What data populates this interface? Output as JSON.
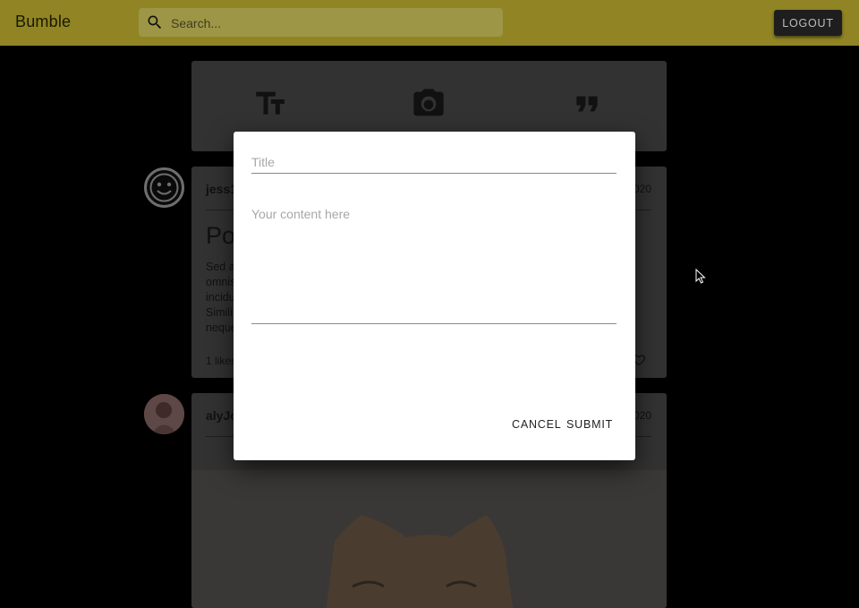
{
  "app": {
    "title": "Bumble"
  },
  "search": {
    "placeholder": "Search...",
    "icon": "search-icon"
  },
  "header": {
    "logout_label": "LOGOUT"
  },
  "composer": {
    "options": [
      "text-format-icon",
      "camera-icon",
      "quote-icon"
    ]
  },
  "posts": [
    {
      "username": "jess1",
      "date": "020",
      "title": "Po",
      "body_lines": [
        "Sed a",
        "omnis",
        "incidu",
        "Simili",
        "neque"
      ],
      "likes": "1 likes"
    },
    {
      "username": "alyJo",
      "date": "020"
    }
  ],
  "dialog": {
    "title_placeholder": "Title",
    "content_placeholder": "Your content here",
    "cancel_label": "CANCEL",
    "submit_label": "SUBMIT"
  },
  "colors": {
    "appbar": "#908424",
    "backdrop": "#000000",
    "dialog": "#ffffff"
  }
}
